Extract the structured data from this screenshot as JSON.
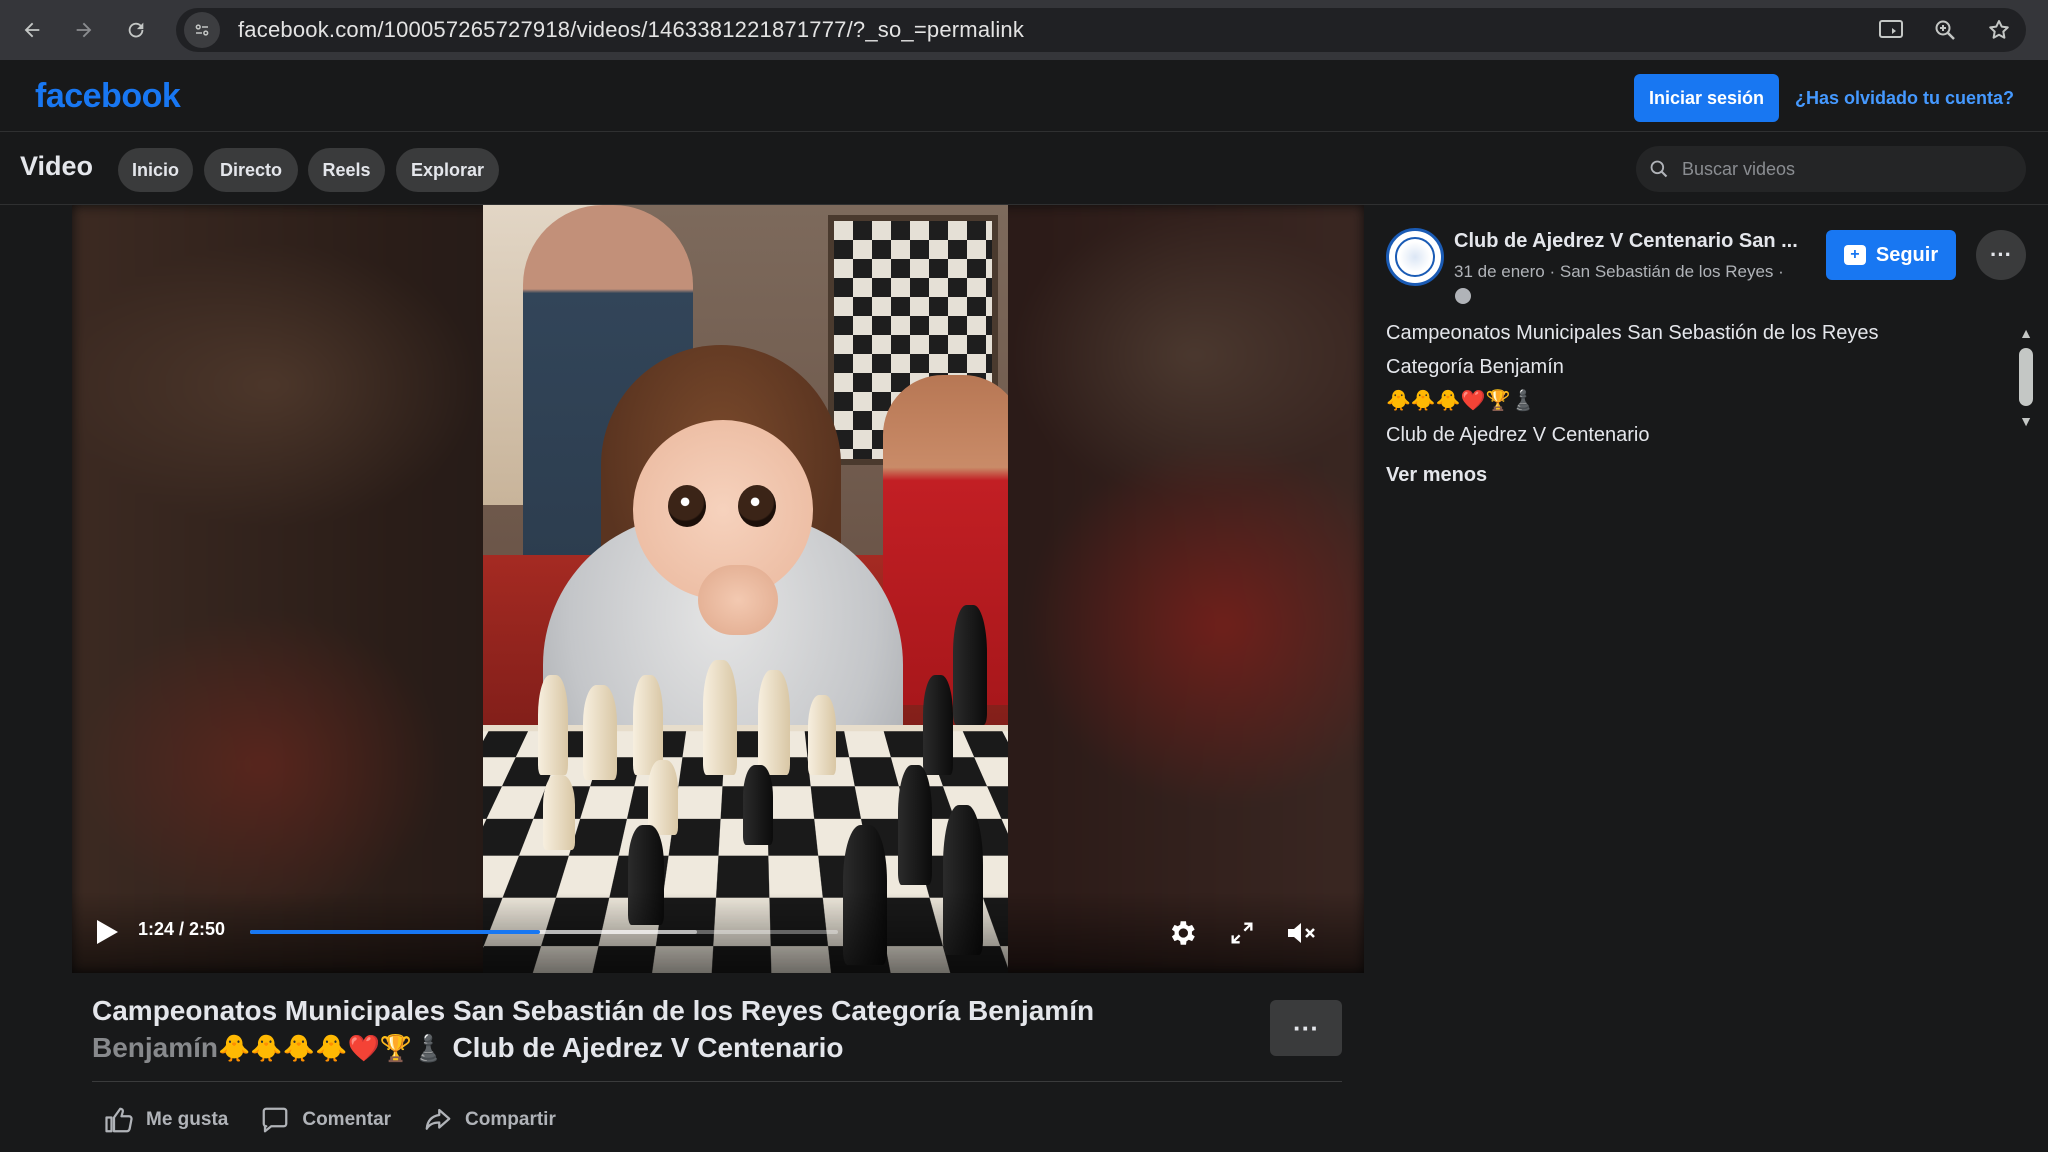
{
  "browser": {
    "url": "facebook.com/100057265727918/videos/1463381221871777/?_so_=permalink",
    "back_icon": "back-arrow-icon",
    "forward_icon": "forward-arrow-icon",
    "reload_icon": "reload-icon"
  },
  "header": {
    "logo": "facebook",
    "login_label": "Iniciar sesión",
    "forgot_label": "¿Has olvidado tu cuenta?"
  },
  "video_nav": {
    "title": "Video",
    "tabs": [
      {
        "label": "Inicio"
      },
      {
        "label": "Directo"
      },
      {
        "label": "Reels"
      },
      {
        "label": "Explorar"
      }
    ],
    "search_placeholder": "Buscar videos"
  },
  "player": {
    "time": "1:24 / 2:50",
    "progress": 0.494,
    "buffered": 0.76
  },
  "post": {
    "title_line1": "Campeonatos Municipales San Sebastián de los Reyes Categoría Benjamín",
    "title_line2_prefix": "Benjamín",
    "title_emojis": "🐥🐥🐥🐥❤️🏆♟️",
    "title_line2_suffix": "Club de Ajedrez V Centenario",
    "actions": {
      "like": "Me gusta",
      "comment": "Comentar",
      "share": "Compartir"
    }
  },
  "side": {
    "page_name": "Club de Ajedrez V Centenario San ...",
    "meta": "31 de enero · San Sebastián de los Reyes ·",
    "follow_label": "Seguir",
    "description": [
      "Campeonatos Municipales San Sebastión de los Reyes",
      "Categoría Benjamín",
      "🐥🐥🐥❤️🏆♟️",
      "Club de Ajedrez V Centenario"
    ],
    "ver_menos": "Ver menos"
  },
  "colors": {
    "accent": "#1877f2",
    "link": "#4599ff",
    "background": "#18191a"
  }
}
